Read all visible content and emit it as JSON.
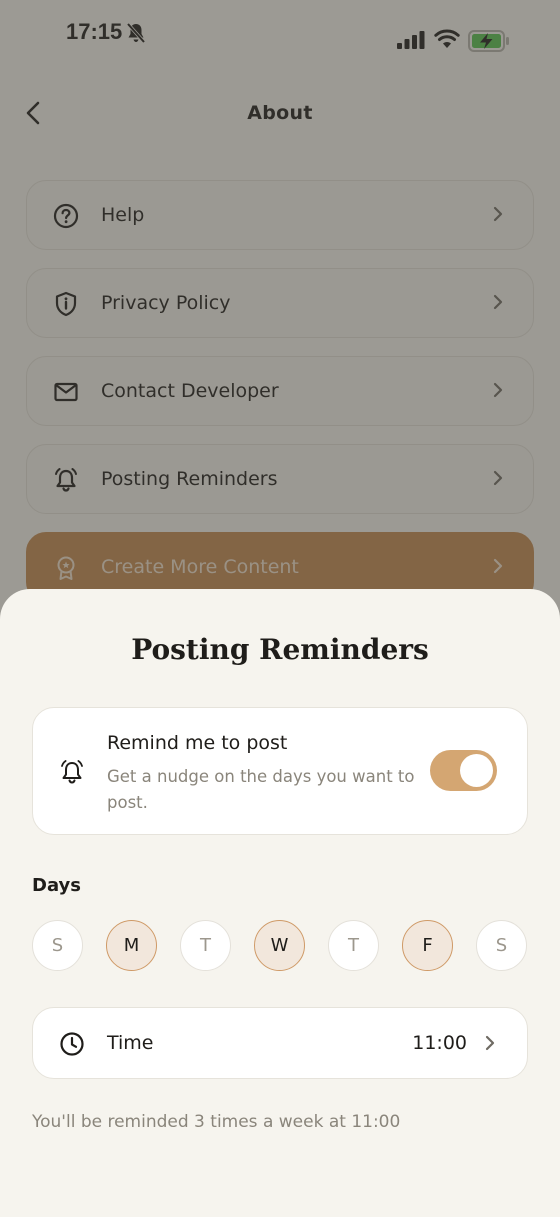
{
  "status_bar": {
    "time": "17:15",
    "icons": [
      "bell-slash-icon",
      "cellular-signal-icon",
      "wifi-icon",
      "battery-charging-icon"
    ]
  },
  "nav": {
    "title": "About",
    "back_icon": "chevron-left-icon"
  },
  "menu": {
    "items": [
      {
        "label": "Help",
        "icon": "question-circle-icon"
      },
      {
        "label": "Privacy Policy",
        "icon": "shield-info-icon"
      },
      {
        "label": "Contact Developer",
        "icon": "envelope-icon"
      },
      {
        "label": "Posting Reminders",
        "icon": "alarm-bell-icon"
      },
      {
        "label": "Create More Content",
        "icon": "award-badge-icon"
      }
    ]
  },
  "sheet": {
    "title": "Posting Reminders",
    "reminder": {
      "title": "Remind me to post",
      "description": "Get a nudge on the days you want to post.",
      "enabled": true
    },
    "days_label": "Days",
    "days": [
      {
        "letter": "S",
        "selected": false
      },
      {
        "letter": "M",
        "selected": true
      },
      {
        "letter": "T",
        "selected": false
      },
      {
        "letter": "W",
        "selected": true
      },
      {
        "letter": "T",
        "selected": false
      },
      {
        "letter": "F",
        "selected": true
      },
      {
        "letter": "S",
        "selected": false
      }
    ],
    "time": {
      "label": "Time",
      "value": "11:00"
    },
    "summary": "You'll be reminded 3 times a week at 11:00"
  },
  "colors": {
    "accent": "#c58a51",
    "toggle_on": "#d4a672",
    "selected_day_bg": "#f2e7dc",
    "selected_day_border": "#cf9a67",
    "sheet_bg": "#f6f4ee"
  }
}
